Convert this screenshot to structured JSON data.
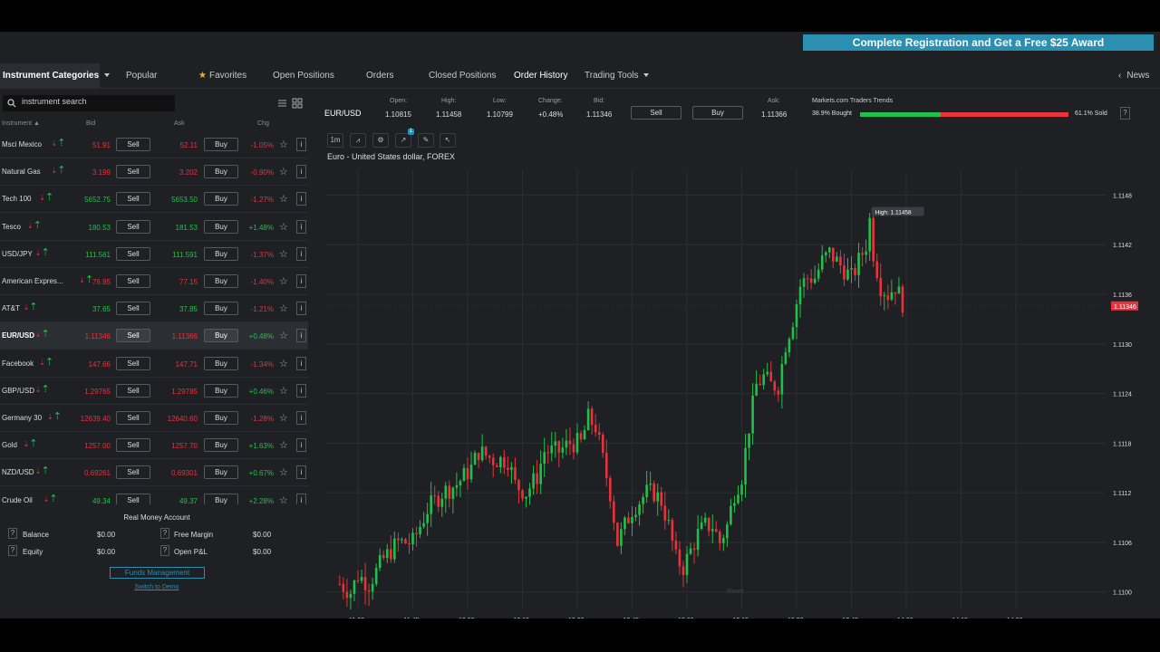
{
  "promo": {
    "label": "Complete Registration and Get a Free $25 Award"
  },
  "nav": {
    "categories": "Instrument Categories",
    "popular": "Popular",
    "favorites": "Favorites",
    "open_positions": "Open Positions",
    "orders": "Orders",
    "closed_positions": "Closed Positions",
    "order_history": "Order History",
    "trading_tools": "Trading Tools",
    "news": "News"
  },
  "search": {
    "value": "instrument search"
  },
  "columns": {
    "instrument": "Instrument",
    "bid": "Bid",
    "ask": "Ask",
    "chg": "Chg"
  },
  "buttons": {
    "sell": "Sell",
    "buy": "Buy",
    "info": "i"
  },
  "instruments": [
    {
      "name": "Msci Mexico",
      "bid": "51.91",
      "ask": "52.11",
      "chg": "-1.05%",
      "bid_dir": "dn",
      "ask_dir": "dn",
      "chg_dir": "dn"
    },
    {
      "name": "Natural Gas",
      "bid": "3.199",
      "ask": "3.202",
      "chg": "-0.90%",
      "bid_dir": "dn",
      "ask_dir": "dn",
      "chg_dir": "dn"
    },
    {
      "name": "Tech 100",
      "bid": "5652.75",
      "ask": "5653.50",
      "chg": "-1.27%",
      "bid_dir": "up",
      "ask_dir": "up",
      "chg_dir": "dn"
    },
    {
      "name": "Tesco",
      "bid": "180.53",
      "ask": "181.53",
      "chg": "+1.48%",
      "bid_dir": "up",
      "ask_dir": "up",
      "chg_dir": "up"
    },
    {
      "name": "USD/JPY",
      "bid": "111.561",
      "ask": "111.591",
      "chg": "-1.37%",
      "bid_dir": "up",
      "ask_dir": "up",
      "chg_dir": "dn"
    },
    {
      "name": "American Expres...",
      "bid": "76.95",
      "ask": "77.15",
      "chg": "-1.40%",
      "bid_dir": "dn",
      "ask_dir": "dn",
      "chg_dir": "dn"
    },
    {
      "name": "AT&T",
      "bid": "37.65",
      "ask": "37.85",
      "chg": "-1.21%",
      "bid_dir": "up",
      "ask_dir": "up",
      "chg_dir": "dn"
    },
    {
      "name": "EUR/USD",
      "bid": "1.11346",
      "ask": "1.11366",
      "chg": "+0.48%",
      "bid_dir": "dn",
      "ask_dir": "dn",
      "chg_dir": "up"
    },
    {
      "name": "Facebook",
      "bid": "147.66",
      "ask": "147.71",
      "chg": "-1.34%",
      "bid_dir": "dn",
      "ask_dir": "dn",
      "chg_dir": "dn"
    },
    {
      "name": "GBP/USD",
      "bid": "1.29765",
      "ask": "1.29785",
      "chg": "+0.46%",
      "bid_dir": "dn",
      "ask_dir": "dn",
      "chg_dir": "up"
    },
    {
      "name": "Germany 30",
      "bid": "12639.40",
      "ask": "12640.60",
      "chg": "-1.28%",
      "bid_dir": "dn",
      "ask_dir": "dn",
      "chg_dir": "dn"
    },
    {
      "name": "Gold",
      "bid": "1257.00",
      "ask": "1257.70",
      "chg": "+1.63%",
      "bid_dir": "dn",
      "ask_dir": "dn",
      "chg_dir": "up"
    },
    {
      "name": "NZD/USD",
      "bid": "0.69261",
      "ask": "0.69301",
      "chg": "+0.67%",
      "bid_dir": "dn",
      "ask_dir": "dn",
      "chg_dir": "up"
    },
    {
      "name": "Crude Oil",
      "bid": "49.34",
      "ask": "49.37",
      "chg": "+2.28%",
      "bid_dir": "up",
      "ask_dir": "up",
      "chg_dir": "up"
    }
  ],
  "account": {
    "title": "Real Money Account",
    "balance_label": "Balance",
    "balance": "$0.00",
    "equity_label": "Equity",
    "equity": "$0.00",
    "free_margin_label": "Free Margin",
    "free_margin": "$0.00",
    "open_pl_label": "Open P&L",
    "open_pl": "$0.00",
    "funds_button": "Funds Management",
    "switch_link": "Switch to Demo"
  },
  "quote": {
    "symbol": "EUR/USD",
    "open_label": "Open:",
    "open": "1.10815",
    "high_label": "High:",
    "high": "1.11458",
    "low_label": "Low:",
    "low": "1.10799",
    "change_label": "Change:",
    "change": "+0.48%",
    "bid_label": "Bid:",
    "bid": "1.11346",
    "ask_label": "Ask:",
    "ask": "1.11366",
    "sell": "Sell",
    "buy": "Buy",
    "trends_label": "Markets.com Traders Trends",
    "bought": "38.9% Bought",
    "bought_fraction": 0.389,
    "sold": "61.1% Sold"
  },
  "chart_toolbar": {
    "timeframe": "1m",
    "badge": "1"
  },
  "chart_data": {
    "type": "candlestick",
    "title": "Euro - United States dollar, FOREX",
    "high_marker": "High: 1.11458",
    "last_price": "1.11346",
    "reset_label": "Reset",
    "ylim": [
      1.1098,
      1.1151
    ],
    "yticks": [
      "1.1148",
      "1.1142",
      "1.1136",
      "1.1130",
      "1.1124",
      "1.1118",
      "1.1112",
      "1.1106",
      "1.1100"
    ],
    "xticks": [
      "11:30",
      "11:45",
      "12:00",
      "12:15",
      "12:30",
      "12:45",
      "13:00",
      "13:15",
      "13:30",
      "13:45",
      "14:00",
      "14:15",
      "14:30"
    ],
    "start_time": "11:25",
    "path": [
      [
        0,
        1.1101
      ],
      [
        3,
        1.11
      ],
      [
        5,
        1.1102
      ],
      [
        8,
        1.1101
      ],
      [
        12,
        1.1104
      ],
      [
        16,
        1.1106
      ],
      [
        20,
        1.1106
      ],
      [
        24,
        1.111
      ],
      [
        28,
        1.1112
      ],
      [
        32,
        1.1113
      ],
      [
        36,
        1.1115
      ],
      [
        38,
        1.1117
      ],
      [
        42,
        1.1116
      ],
      [
        46,
        1.1116
      ],
      [
        48,
        1.1113
      ],
      [
        51,
        1.1112
      ],
      [
        54,
        1.1114
      ],
      [
        56,
        1.1117
      ],
      [
        60,
        1.1117
      ],
      [
        63,
        1.1118
      ],
      [
        66,
        1.1118
      ],
      [
        68,
        1.1121
      ],
      [
        70,
        1.112
      ],
      [
        72,
        1.1116
      ],
      [
        74,
        1.1112
      ],
      [
        76,
        1.1106
      ],
      [
        78,
        1.1108
      ],
      [
        80,
        1.111
      ],
      [
        82,
        1.1111
      ],
      [
        84,
        1.1112
      ],
      [
        86,
        1.1112
      ],
      [
        88,
        1.1111
      ],
      [
        90,
        1.1108
      ],
      [
        92,
        1.1104
      ],
      [
        94,
        1.1103
      ],
      [
        96,
        1.1105
      ],
      [
        98,
        1.1107
      ],
      [
        100,
        1.1108
      ],
      [
        102,
        1.1108
      ],
      [
        104,
        1.1106
      ],
      [
        106,
        1.1108
      ],
      [
        108,
        1.1112
      ],
      [
        110,
        1.1114
      ],
      [
        112,
        1.112
      ],
      [
        114,
        1.1125
      ],
      [
        116,
        1.1126
      ],
      [
        118,
        1.1125
      ],
      [
        120,
        1.1125
      ],
      [
        122,
        1.113
      ],
      [
        124,
        1.1133
      ],
      [
        126,
        1.1137
      ],
      [
        128,
        1.1138
      ],
      [
        130,
        1.1138
      ],
      [
        132,
        1.114
      ],
      [
        134,
        1.1141
      ],
      [
        136,
        1.114
      ],
      [
        138,
        1.1139
      ],
      [
        140,
        1.1138
      ],
      [
        142,
        1.114
      ],
      [
        144,
        1.1142
      ],
      [
        145,
        1.1145
      ],
      [
        146,
        1.1141
      ],
      [
        147,
        1.1139
      ],
      [
        148,
        1.1137
      ],
      [
        150,
        1.1136
      ],
      [
        152,
        1.1137
      ],
      [
        154,
        1.1135
      ]
    ]
  }
}
